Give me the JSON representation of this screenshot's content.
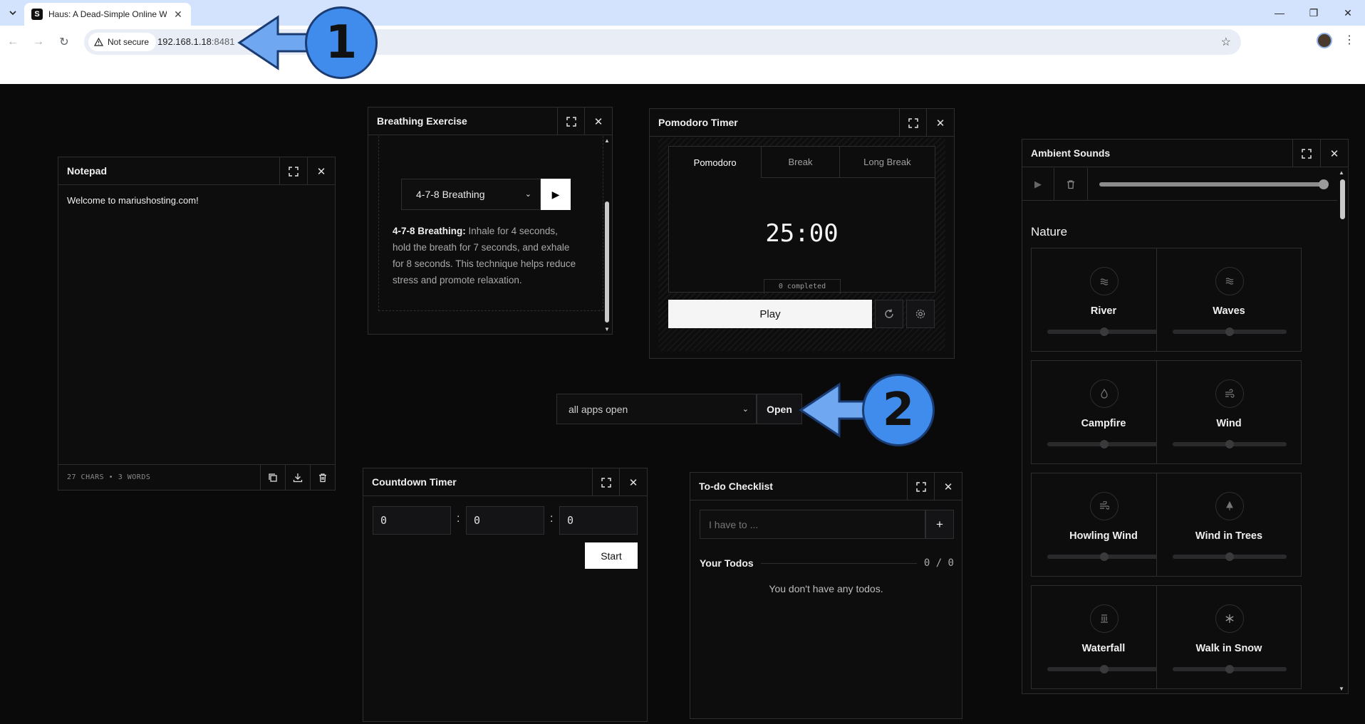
{
  "browser": {
    "tab_title": "Haus: A Dead-Simple Online W",
    "security_label": "Not secure",
    "url_host": "192.168.1.18",
    "url_port": ":8481"
  },
  "notepad": {
    "title": "Notepad",
    "text": "Welcome to mariushosting.com!",
    "stats": "27 CHARS • 3 WORDS"
  },
  "breathing": {
    "title": "Breathing Exercise",
    "selected": "4-7-8 Breathing",
    "desc_label": "4-7-8 Breathing:",
    "desc_text": " Inhale for 4 seconds, hold the breath for 7 seconds, and exhale for 8 seconds. This technique helps reduce stress and promote relaxation."
  },
  "pomodoro": {
    "title": "Pomodoro Timer",
    "tabs": [
      "Pomodoro",
      "Break",
      "Long Break"
    ],
    "time": "25:00",
    "completed": "0 completed",
    "play_label": "Play"
  },
  "apps": {
    "selected": "all apps open",
    "open_label": "Open"
  },
  "countdown": {
    "title": "Countdown Timer",
    "hours": "0",
    "minutes": "0",
    "seconds": "0",
    "start_label": "Start"
  },
  "todo": {
    "title": "To-do Checklist",
    "placeholder": "I have to ...",
    "section": "Your Todos",
    "count": "0 / 0",
    "empty": "You don't have any todos."
  },
  "ambient": {
    "title": "Ambient Sounds",
    "master_volume": 1.0,
    "section": "Nature",
    "sounds": [
      {
        "name": "River",
        "icon": "river-icon"
      },
      {
        "name": "Waves",
        "icon": "waves-icon"
      },
      {
        "name": "Campfire",
        "icon": "campfire-icon"
      },
      {
        "name": "Wind",
        "icon": "wind-icon"
      },
      {
        "name": "Howling Wind",
        "icon": "howling-wind-icon"
      },
      {
        "name": "Wind in Trees",
        "icon": "tree-icon"
      },
      {
        "name": "Waterfall",
        "icon": "waterfall-icon"
      },
      {
        "name": "Walk in Snow",
        "icon": "snowflake-icon"
      }
    ]
  },
  "annotations": {
    "callout_1": "1",
    "callout_2": "2",
    "accent_color": "#3f8cec"
  }
}
